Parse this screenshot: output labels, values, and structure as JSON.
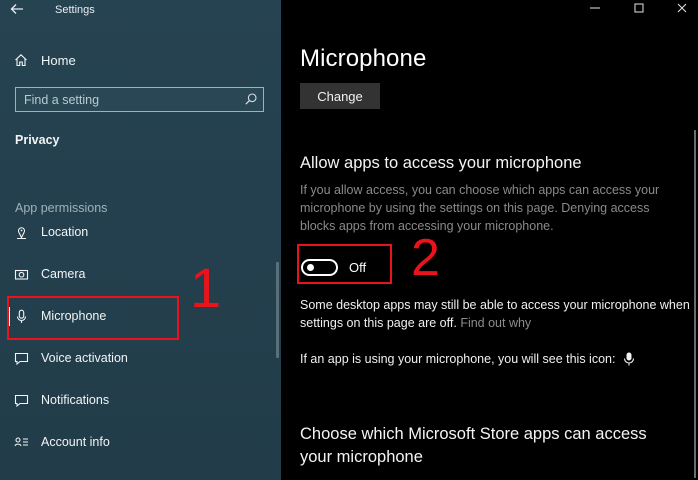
{
  "window": {
    "title": "Settings",
    "back_icon": "arrow-left-icon",
    "controls": [
      "minimize-icon",
      "maximize-icon",
      "close-icon"
    ]
  },
  "sidebar": {
    "home_label": "Home",
    "search_placeholder": "Find a setting",
    "category": "Privacy",
    "section_label": "App permissions",
    "items": [
      {
        "label": "Location",
        "icon": "location-icon"
      },
      {
        "label": "Camera",
        "icon": "camera-icon"
      },
      {
        "label": "Microphone",
        "icon": "microphone-icon",
        "selected": true
      },
      {
        "label": "Voice activation",
        "icon": "voice-activation-icon"
      },
      {
        "label": "Notifications",
        "icon": "notifications-icon"
      },
      {
        "label": "Account info",
        "icon": "account-info-icon"
      }
    ]
  },
  "main": {
    "title": "Microphone",
    "change_button": "Change",
    "allow_heading": "Allow apps to access your microphone",
    "allow_description": "If you allow access, you can choose which apps can access your microphone by using the settings on this page. Denying access blocks apps from accessing your microphone.",
    "toggle_state": "Off",
    "desktop_note": "Some desktop apps may still be able to access your microphone when settings on this page are off.",
    "desktop_note_link": "Find out why",
    "icon_note": "If an app is using your microphone, you will see this icon:",
    "store_heading": "Choose which Microsoft Store apps can access your microphone"
  },
  "annotations": {
    "marker_1": "1",
    "marker_2": "2",
    "color": "#e8131b"
  },
  "colors": {
    "sidebar_bg": "#243f4d",
    "content_bg": "#000000",
    "button_bg": "#333333"
  }
}
